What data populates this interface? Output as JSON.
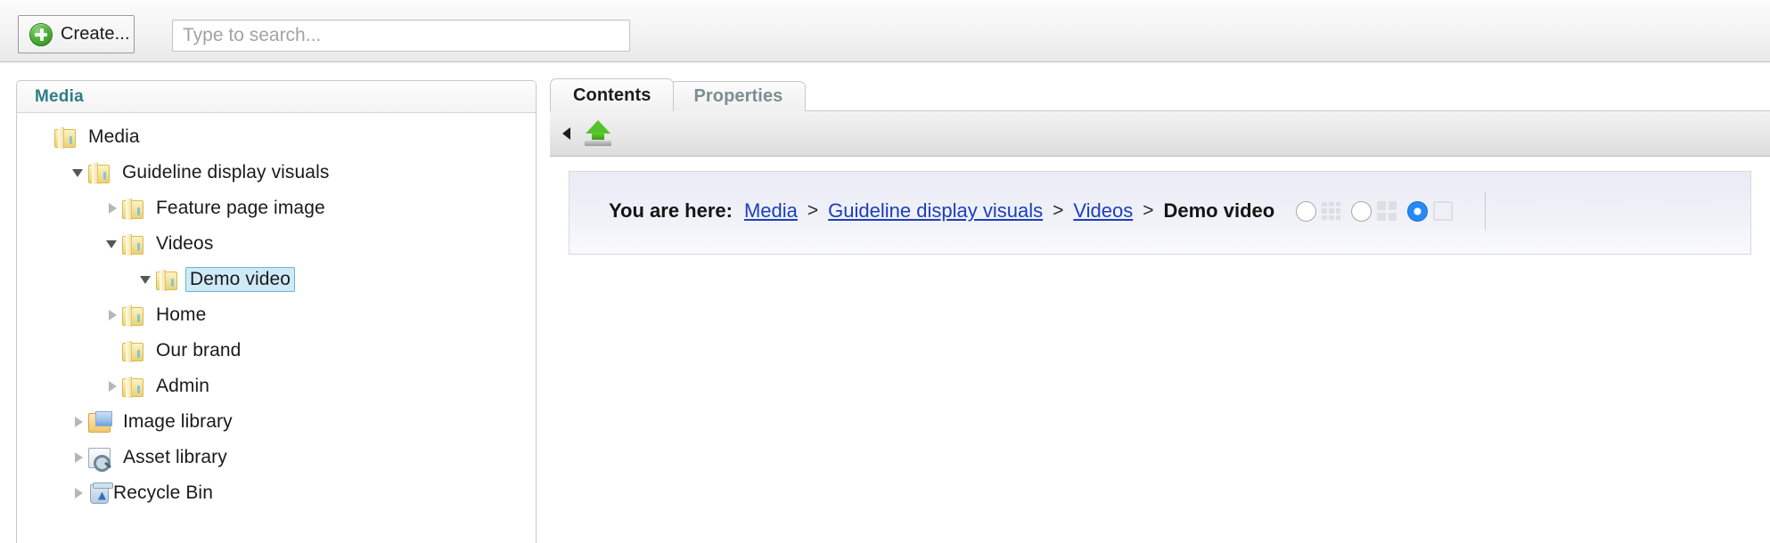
{
  "toolbar": {
    "create_label": "Create...",
    "create_icon": "green-plus-icon",
    "search_placeholder": "Type to search...",
    "search_value": ""
  },
  "tree_panel": {
    "header_title": "Media",
    "header_color": "#2e7d86",
    "items": [
      {
        "label": "Media",
        "depth": 0,
        "icon": "folder-icon",
        "twisty": "none",
        "selected": false
      },
      {
        "label": "Guideline display visuals",
        "depth": 1,
        "icon": "folder-icon",
        "twisty": "open",
        "selected": false
      },
      {
        "label": "Feature page image",
        "depth": 2,
        "icon": "folder-icon",
        "twisty": "closed",
        "selected": false
      },
      {
        "label": "Videos",
        "depth": 2,
        "icon": "folder-icon",
        "twisty": "open",
        "selected": false
      },
      {
        "label": "Demo video",
        "depth": 3,
        "icon": "folder-icon",
        "twisty": "open",
        "selected": true
      },
      {
        "label": "Home",
        "depth": 2,
        "icon": "folder-icon",
        "twisty": "closed",
        "selected": false
      },
      {
        "label": "Our brand",
        "depth": 2,
        "icon": "folder-icon",
        "twisty": "none",
        "selected": false
      },
      {
        "label": "Admin",
        "depth": 2,
        "icon": "folder-icon",
        "twisty": "closed",
        "selected": false
      },
      {
        "label": "Image library",
        "depth": 1,
        "icon": "image-library-icon",
        "twisty": "closed",
        "selected": false
      },
      {
        "label": "Asset library",
        "depth": 1,
        "icon": "asset-library-icon",
        "twisty": "closed",
        "selected": false
      },
      {
        "label": "Recycle Bin",
        "depth": 1,
        "icon": "recycle-bin-icon",
        "twisty": "closed",
        "selected": false
      }
    ]
  },
  "content": {
    "tabs": [
      {
        "label": "Contents",
        "active": true
      },
      {
        "label": "Properties",
        "active": false
      }
    ],
    "panel_toolbar": {
      "collapse_icon": "collapse-left-arrow-icon",
      "upload_icon": "upload-arrow-icon"
    },
    "breadcrumb": {
      "label": "You are here:",
      "links": [
        "Media",
        "Guideline display visuals",
        "Videos"
      ],
      "separator": ">",
      "current": "Demo video"
    },
    "view_toggle": {
      "options": [
        {
          "icon": "grid-small-icon",
          "selected": false
        },
        {
          "icon": "grid-medium-icon",
          "selected": false
        },
        {
          "icon": "grid-large-icon",
          "selected": true
        }
      ],
      "selected_color": "#2789f5"
    }
  }
}
